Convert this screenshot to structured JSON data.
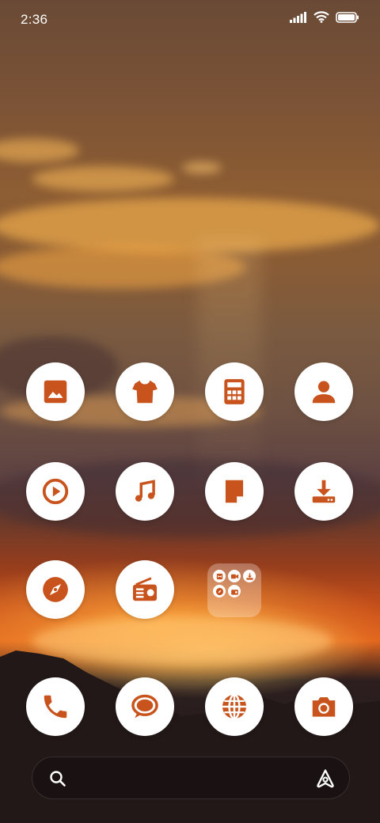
{
  "status_bar": {
    "time": "2:36"
  },
  "accent_color": "#c8531c",
  "apps": {
    "row1": [
      "gallery-icon",
      "themes-icon",
      "calculator-icon",
      "contacts-icon"
    ],
    "row2": [
      "music-player-icon",
      "music-icon",
      "notes-icon",
      "downloads-icon"
    ],
    "row3": [
      "compass-icon",
      "radio-icon",
      "app-folder"
    ],
    "dock": [
      "phone-icon",
      "messages-icon",
      "browser-icon",
      "camera-icon"
    ]
  },
  "folder_items": [
    "recorder-icon",
    "video-icon",
    "download-icon",
    "compass-icon",
    "radio-icon"
  ],
  "search": {
    "placeholder": ""
  }
}
